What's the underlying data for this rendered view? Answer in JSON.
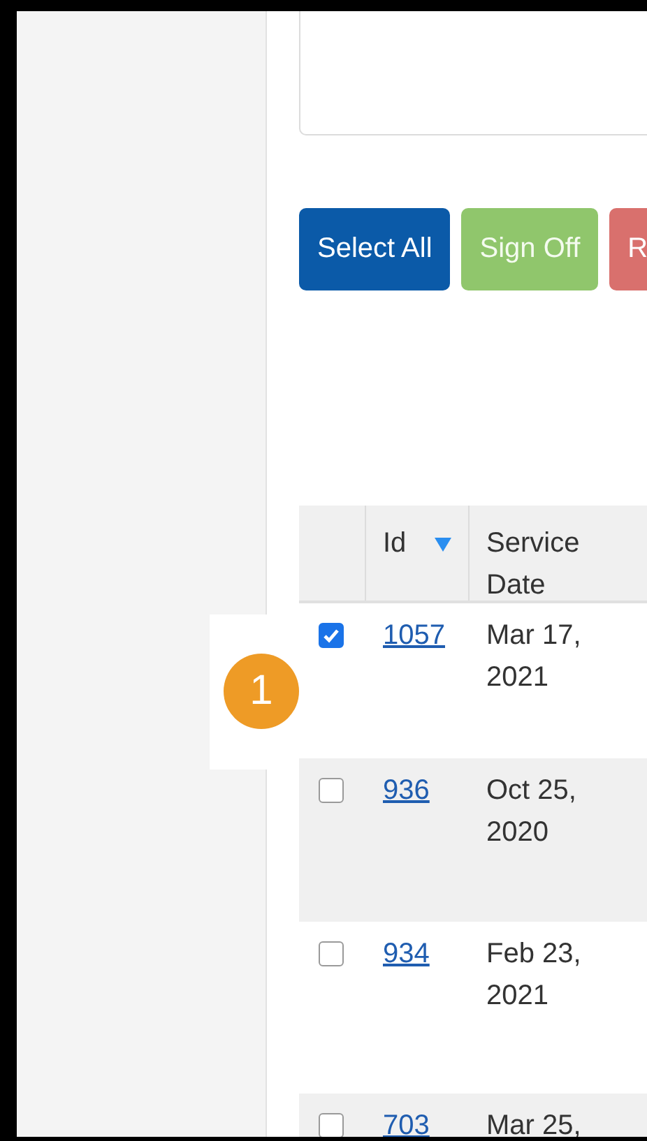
{
  "buttons": [
    {
      "label": "Select All",
      "kind": "primary"
    },
    {
      "label": "Sign Off",
      "kind": "success"
    },
    {
      "label": "R",
      "kind": "danger"
    }
  ],
  "table": {
    "columns": [
      {
        "label": "Id",
        "sorted": true
      },
      {
        "label": "Service Date",
        "sorted": false
      }
    ],
    "rows": [
      {
        "id": "1057",
        "service_date": "Mar 17, 2021",
        "checked": true
      },
      {
        "id": "936",
        "service_date": "Oct 25, 2020",
        "checked": false
      },
      {
        "id": "934",
        "service_date": "Feb 23, 2021",
        "checked": false
      },
      {
        "id": "703",
        "service_date": "Mar 25,",
        "checked": false
      }
    ]
  },
  "callout": {
    "number": "1"
  }
}
